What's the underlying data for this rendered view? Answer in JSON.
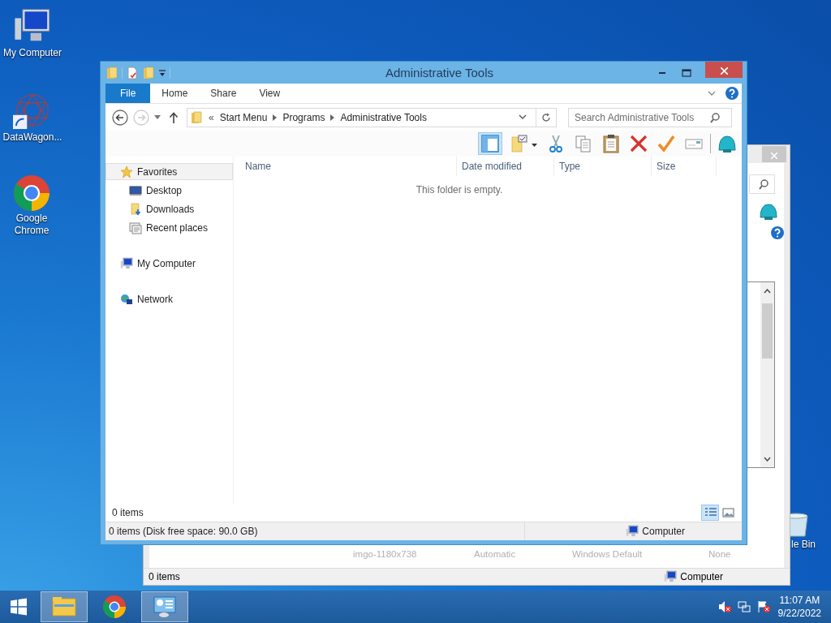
{
  "desktop_icons": [
    {
      "kind": "computer",
      "label": "My Computer"
    },
    {
      "kind": "datawagon",
      "label": "DataWagon..."
    },
    {
      "kind": "chrome",
      "label": "Google Chrome"
    },
    {
      "kind": "bin",
      "label": "le Bin"
    }
  ],
  "background_window": {
    "row": [
      "imgo-1180x738",
      "Automatic",
      "Windows Default",
      "None"
    ],
    "status_left": "0 items",
    "status_right": "Computer"
  },
  "window": {
    "title": "Administrative Tools",
    "ribbon_tabs": [
      {
        "label": "File",
        "selected": true
      },
      {
        "label": "Home",
        "selected": false
      },
      {
        "label": "Share",
        "selected": false
      },
      {
        "label": "View",
        "selected": false
      }
    ],
    "breadcrumb_overflow": "«",
    "breadcrumb": [
      "Start Menu",
      "Programs",
      "Administrative Tools"
    ],
    "search": {
      "placeholder": "Search Administrative Tools"
    },
    "nav": [
      {
        "kind": "favorites",
        "label": "Favorites",
        "selected": true,
        "children": [
          {
            "kind": "desktop",
            "label": "Desktop",
            "selected": false
          },
          {
            "kind": "downloads",
            "label": "Downloads",
            "selected": false
          },
          {
            "kind": "recent",
            "label": "Recent places",
            "selected": false
          }
        ]
      },
      {
        "kind": "computer",
        "label": "My Computer",
        "selected": false
      },
      {
        "kind": "network",
        "label": "Network",
        "selected": false
      }
    ],
    "columns": [
      "Name",
      "Date modified",
      "Type",
      "Size"
    ],
    "empty_message": "This folder is empty.",
    "item_count": "0 items",
    "views": [
      {
        "kind": "details",
        "selected": true
      },
      {
        "kind": "large",
        "selected": false
      }
    ],
    "status_text": "0 items (Disk free space: 90.0 GB)",
    "status_location": "Computer"
  },
  "taskbar": {
    "items": [
      {
        "kind": "explorer",
        "active": true
      },
      {
        "kind": "chrome",
        "active": false
      },
      {
        "kind": "control-panel",
        "active": true
      }
    ],
    "time": "11:07 AM",
    "date": "9/22/2022"
  }
}
